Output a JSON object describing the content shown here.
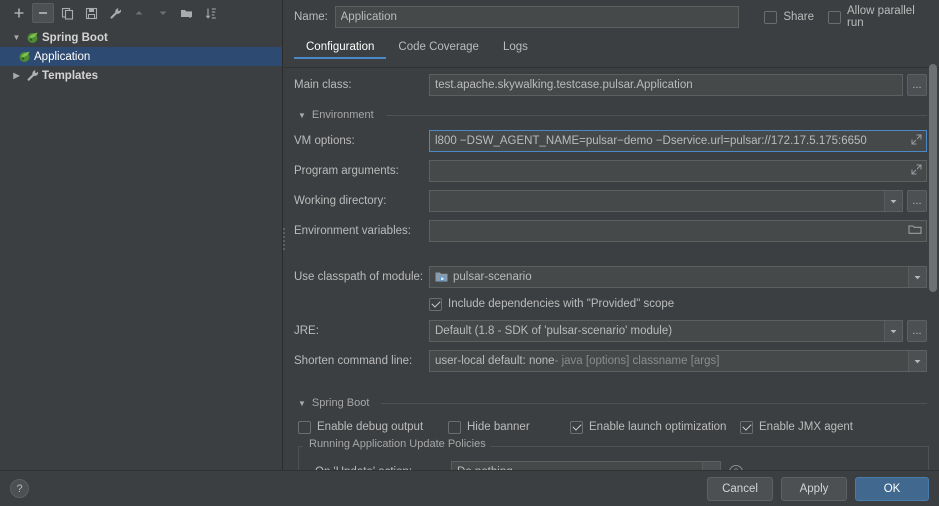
{
  "toolbar": {
    "buttons": [
      {
        "name": "add",
        "icon": "plus-icon",
        "label": "+"
      },
      {
        "name": "remove",
        "icon": "minus-icon",
        "label": "−"
      },
      {
        "name": "copy",
        "icon": "copy-icon",
        "label": "Copy Configuration"
      },
      {
        "name": "save",
        "icon": "save-icon",
        "label": "Save Configuration"
      },
      {
        "name": "edit-templates",
        "icon": "wrench-icon",
        "label": "Edit Templates"
      },
      {
        "name": "move-up",
        "icon": "arrow-up-icon",
        "label": "Move Up"
      },
      {
        "name": "move-down",
        "icon": "arrow-down-icon",
        "label": "Move Down"
      },
      {
        "name": "new-folder",
        "icon": "folder-add-icon",
        "label": "Create New Folder"
      },
      {
        "name": "sort",
        "icon": "sort-alpha-icon",
        "label": "Sort Configurations"
      }
    ]
  },
  "tree": {
    "nodes": [
      {
        "label": "Spring Boot",
        "icon": "spring-boot-icon",
        "expanded": true,
        "selected": false,
        "bold": true,
        "caret": "▼"
      },
      {
        "label": "Application",
        "icon": "spring-boot-icon",
        "expanded": false,
        "selected": true,
        "bold": false,
        "caret": ""
      },
      {
        "label": "Templates",
        "icon": "wrench-icon",
        "expanded": false,
        "selected": false,
        "bold": true,
        "caret": "▶"
      }
    ]
  },
  "header": {
    "name_label": "Name:",
    "name_value": "Application",
    "name_placeholder": "Name",
    "share": {
      "label": "Share",
      "checked": false
    },
    "allow_parallel_run": {
      "label": "Allow parallel run",
      "checked": false
    }
  },
  "tabs": [
    {
      "label": "Configuration",
      "active": true
    },
    {
      "label": "Code Coverage",
      "active": false
    },
    {
      "label": "Logs",
      "active": false
    }
  ],
  "form": {
    "main_class": {
      "label": "Main class:",
      "value": "test.apache.skywalking.testcase.pulsar.Application",
      "placeholder": "",
      "browse_label": "..."
    },
    "environment_section": {
      "title": "Environment",
      "caret": "▼"
    },
    "vm_options": {
      "label": "VM options:",
      "value": "l800 −DSW_AGENT_NAME=pulsar−demo −Dservice.url=pulsar://172.17.5.175:6650",
      "placeholder": "",
      "expand_label": "Expand"
    },
    "program_arguments": {
      "label": "Program arguments:",
      "value": "",
      "placeholder": "",
      "expand_label": "Expand"
    },
    "working_directory": {
      "label": "Working directory:",
      "value": "",
      "placeholder": "",
      "browse_label": "..."
    },
    "environment_variables": {
      "label": "Environment variables:",
      "value": "",
      "placeholder": "",
      "browse_label": "Browse"
    },
    "use_classpath_of_module": {
      "label": "Use classpath of module:",
      "value": "pulsar-scenario",
      "icon": "module-icon"
    },
    "include_provided": {
      "label": "Include dependencies with \"Provided\" scope",
      "checked": true
    },
    "jre": {
      "label": "JRE:",
      "value": "Default (1.8 - SDK of 'pulsar-scenario' module)",
      "browse_label": "..."
    },
    "shorten_command_line": {
      "label": "Shorten command line:",
      "value_strong": "user-local default: none",
      "value_muted": " - java [options] classname [args]"
    },
    "spring_boot_section": {
      "title": "Spring Boot",
      "caret": "▼"
    },
    "spring_boot_checks": [
      {
        "name": "enable-debug-output",
        "label": "Enable debug output",
        "checked": false
      },
      {
        "name": "hide-banner",
        "label": "Hide banner",
        "checked": false
      },
      {
        "name": "enable-launch-optimization",
        "label": "Enable launch optimization",
        "checked": true
      },
      {
        "name": "enable-jmx-agent",
        "label": "Enable JMX agent",
        "checked": true
      }
    ],
    "update_policies": {
      "group_title": "Running Application Update Policies",
      "on_update_label": "On 'Update' action:",
      "on_update_value": "Do nothing",
      "help_label": "?"
    }
  },
  "footer": {
    "help_label": "?",
    "cancel_label": "Cancel",
    "apply_label": "Apply",
    "ok_label": "OK"
  },
  "colors": {
    "background": "#3c3f41",
    "field_background": "#45494a",
    "selection_blue": "#2d4b72",
    "accent_blue": "#4a88c7",
    "primary_button": "#41688f",
    "text": "#bbbbbb",
    "spring_green": "#6aaa3f"
  }
}
